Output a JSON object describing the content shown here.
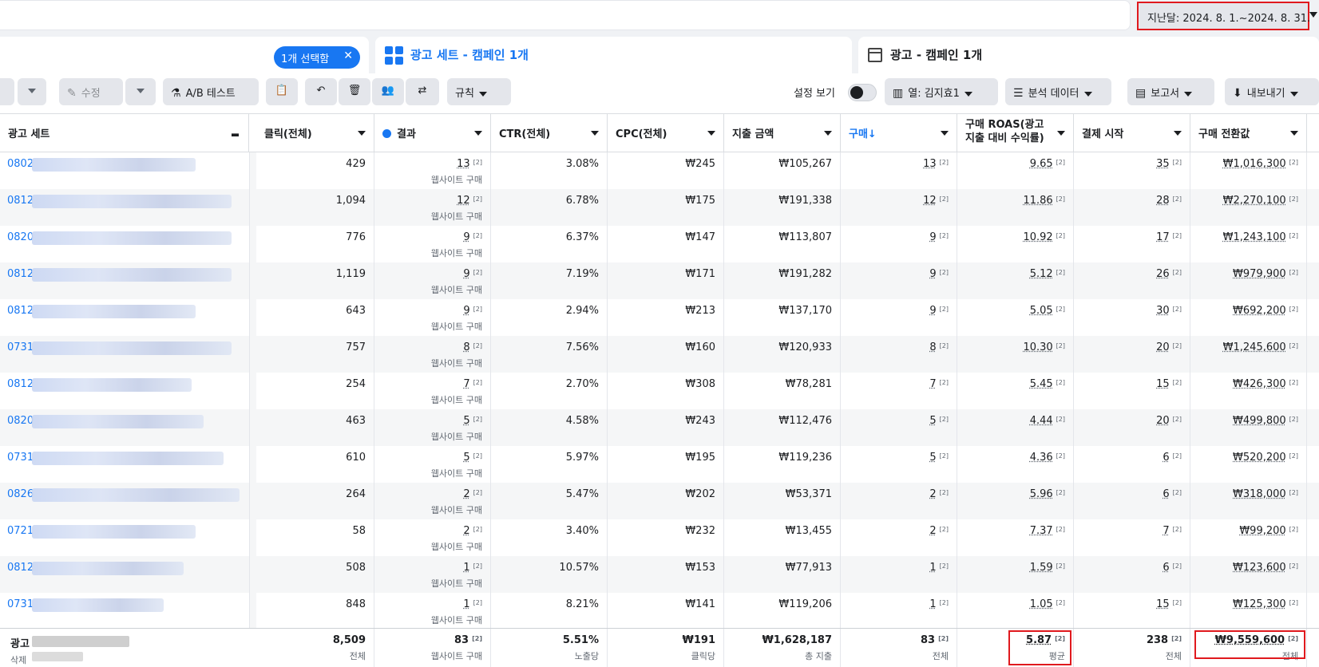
{
  "date_range": "지난달: 2024. 8. 1.~2024. 8. 31.",
  "tabs": {
    "selected_pill": "1개 선택함",
    "adset_tab": "광고 세트 - 캠페인 1개",
    "ad_tab": "광고 - 캠페인 1개"
  },
  "toolbar": {
    "edit": "수정",
    "ab_test": "A/B 테스트",
    "rules": "규칙",
    "view_settings": "설정 보기",
    "columns": "열: 김지효1",
    "breakdown": "분석 데이터",
    "reports": "보고서",
    "export": "내보내기"
  },
  "colors": {
    "accent": "#1877f2",
    "highlight": "#e0191e",
    "stripe": "#f5f6f7"
  },
  "columns": [
    "광고 세트",
    "클릭(전체)",
    "결과",
    "CTR(전체)",
    "CPC(전체)",
    "지출 금액",
    "구매↓",
    "구매 ROAS(광고 지출 대비 수익률)",
    "결제 시작",
    "구매 전환값"
  ],
  "column_heads": {
    "name": "광고 세트",
    "clicks": "클릭(전체)",
    "results": "결과",
    "ctr": "CTR(전체)",
    "cpc": "CPC(전체)",
    "spend": "지출 금액",
    "purchases": "구매↓",
    "roas_l1": "구매 ROAS(광고",
    "roas_l2": "지출 대비 수익률)",
    "checkout": "결제 시작",
    "conv_value": "구매 전환값"
  },
  "result_sub": "웹사이트 구매",
  "superscript": "[2]",
  "rows": [
    {
      "code": "0802",
      "clicks": "429",
      "results": "13",
      "ctr": "3.08%",
      "cpc": "₩245",
      "spend": "₩105,267",
      "purchases": "13",
      "roas": "9.65",
      "checkout": "35",
      "value": "₩1,016,300"
    },
    {
      "code": "0812",
      "clicks": "1,094",
      "results": "12",
      "ctr": "6.78%",
      "cpc": "₩175",
      "spend": "₩191,338",
      "purchases": "12",
      "roas": "11.86",
      "checkout": "28",
      "value": "₩2,270,100"
    },
    {
      "code": "0820",
      "clicks": "776",
      "results": "9",
      "ctr": "6.37%",
      "cpc": "₩147",
      "spend": "₩113,807",
      "purchases": "9",
      "roas": "10.92",
      "checkout": "17",
      "value": "₩1,243,100"
    },
    {
      "code": "0812",
      "clicks": "1,119",
      "results": "9",
      "ctr": "7.19%",
      "cpc": "₩171",
      "spend": "₩191,282",
      "purchases": "9",
      "roas": "5.12",
      "checkout": "26",
      "value": "₩979,900"
    },
    {
      "code": "0812",
      "clicks": "643",
      "results": "9",
      "ctr": "2.94%",
      "cpc": "₩213",
      "spend": "₩137,170",
      "purchases": "9",
      "roas": "5.05",
      "checkout": "30",
      "value": "₩692,200"
    },
    {
      "code": "0731",
      "clicks": "757",
      "results": "8",
      "ctr": "7.56%",
      "cpc": "₩160",
      "spend": "₩120,933",
      "purchases": "8",
      "roas": "10.30",
      "checkout": "20",
      "value": "₩1,245,600"
    },
    {
      "code": "0812",
      "clicks": "254",
      "results": "7",
      "ctr": "2.70%",
      "cpc": "₩308",
      "spend": "₩78,281",
      "purchases": "7",
      "roas": "5.45",
      "checkout": "15",
      "value": "₩426,300"
    },
    {
      "code": "0820",
      "clicks": "463",
      "results": "5",
      "ctr": "4.58%",
      "cpc": "₩243",
      "spend": "₩112,476",
      "purchases": "5",
      "roas": "4.44",
      "checkout": "20",
      "value": "₩499,800"
    },
    {
      "code": "0731",
      "clicks": "610",
      "results": "5",
      "ctr": "5.97%",
      "cpc": "₩195",
      "spend": "₩119,236",
      "purchases": "5",
      "roas": "4.36",
      "checkout": "6",
      "value": "₩520,200"
    },
    {
      "code": "0826",
      "clicks": "264",
      "results": "2",
      "ctr": "5.47%",
      "cpc": "₩202",
      "spend": "₩53,371",
      "purchases": "2",
      "roas": "5.96",
      "checkout": "6",
      "value": "₩318,000"
    },
    {
      "code": "0721",
      "clicks": "58",
      "results": "2",
      "ctr": "3.40%",
      "cpc": "₩232",
      "spend": "₩13,455",
      "purchases": "2",
      "roas": "7.37",
      "checkout": "7",
      "value": "₩99,200"
    },
    {
      "code": "0812",
      "clicks": "508",
      "results": "1",
      "ctr": "10.57%",
      "cpc": "₩153",
      "spend": "₩77,913",
      "purchases": "1",
      "roas": "1.59",
      "checkout": "6",
      "value": "₩123,600"
    },
    {
      "code": "0731",
      "clicks": "848",
      "results": "1",
      "ctr": "8.21%",
      "cpc": "₩141",
      "spend": "₩119,206",
      "purchases": "1",
      "roas": "1.05",
      "checkout": "15",
      "value": "₩125,300"
    }
  ],
  "footer": {
    "name_line1": "광고",
    "name_line2": "삭제",
    "clicks": "8,509",
    "clicks_label": "전체",
    "results": "83",
    "results_label": "웹사이트 구매",
    "ctr": "5.51%",
    "ctr_label": "노출당",
    "cpc": "₩191",
    "cpc_label": "클릭당",
    "spend": "₩1,628,187",
    "spend_label": "총 지출",
    "purchases": "83",
    "purchases_label": "전체",
    "roas": "5.87",
    "roas_label": "평균",
    "checkout": "238",
    "checkout_label": "전체",
    "value": "₩9,559,600",
    "value_label": "전체"
  }
}
